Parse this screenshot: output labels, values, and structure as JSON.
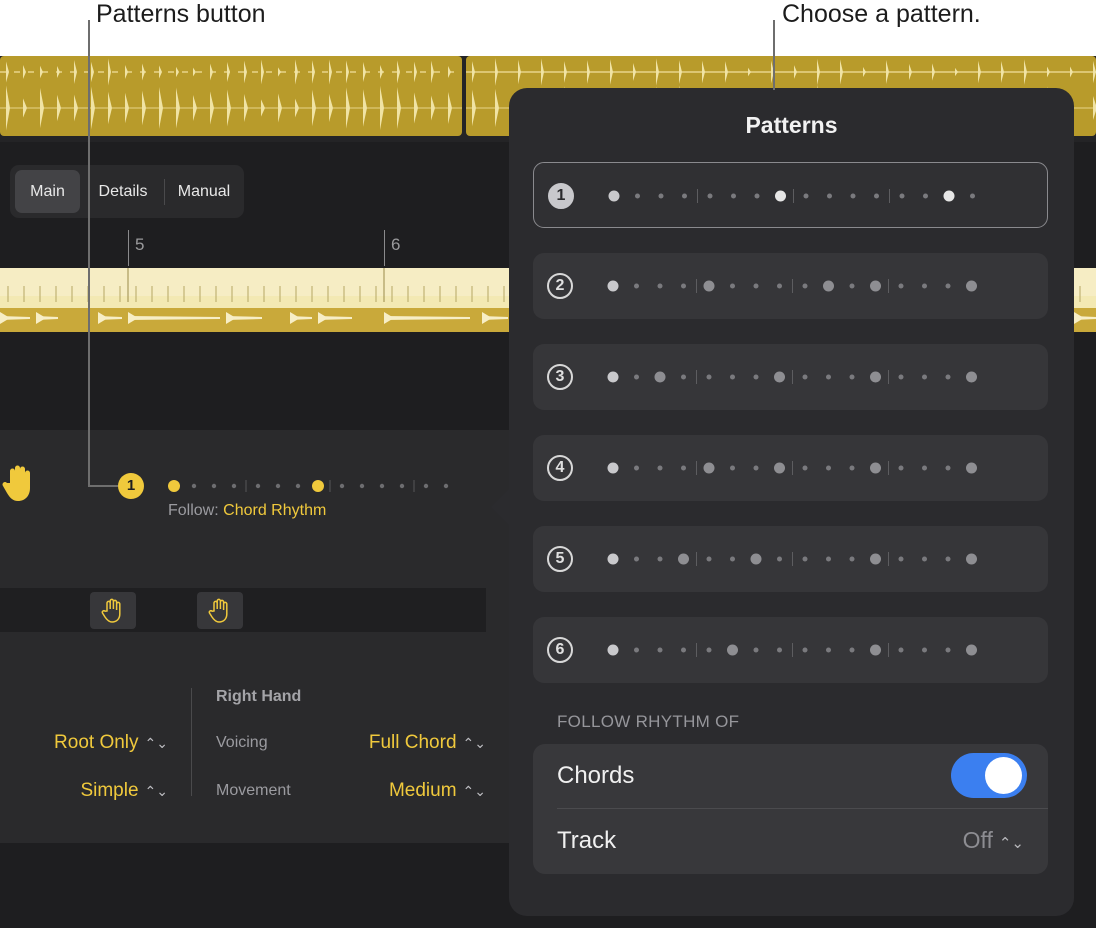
{
  "callouts": {
    "patterns_button": "Patterns button",
    "choose_pattern": "Choose a pattern."
  },
  "tabs": [
    {
      "label": "Main",
      "selected": true
    },
    {
      "label": "Details",
      "selected": false
    },
    {
      "label": "Manual",
      "selected": false
    }
  ],
  "ruler": {
    "bar_5": "5",
    "bar_6": "6"
  },
  "player": {
    "hand_icon": "hand-icon",
    "pattern_number": "1",
    "follow_prefix": "Follow:",
    "follow_value": "Chord Rhythm"
  },
  "settings": {
    "right_hand_header": "Right Hand",
    "left": {
      "voicing_value": "Root Only",
      "movement_value": "Simple"
    },
    "right": {
      "voicing_label": "Voicing",
      "voicing_value": "Full Chord",
      "movement_label": "Movement",
      "movement_value": "Medium"
    }
  },
  "colors": {
    "accent_yellow": "#f0c93c",
    "toggle_blue": "#3b7ff0",
    "region_gold": "#b89b2b"
  },
  "popover": {
    "title": "Patterns",
    "selected_pattern": 1,
    "patterns": [
      {
        "number": "1",
        "big": [
          0,
          7,
          14
        ]
      },
      {
        "number": "2",
        "big": [
          0,
          4,
          9,
          11,
          15
        ]
      },
      {
        "number": "3",
        "big": [
          0,
          2,
          7,
          11,
          15
        ]
      },
      {
        "number": "4",
        "big": [
          0,
          4,
          7,
          11,
          15
        ]
      },
      {
        "number": "5",
        "big": [
          0,
          3,
          6,
          11,
          15
        ]
      },
      {
        "number": "6",
        "big": [
          0,
          5,
          11,
          15
        ]
      }
    ],
    "follow_rhythm_label": "FOLLOW RHYTHM OF",
    "chords_label": "Chords",
    "chords_on": true,
    "track_label": "Track",
    "track_value": "Off"
  }
}
